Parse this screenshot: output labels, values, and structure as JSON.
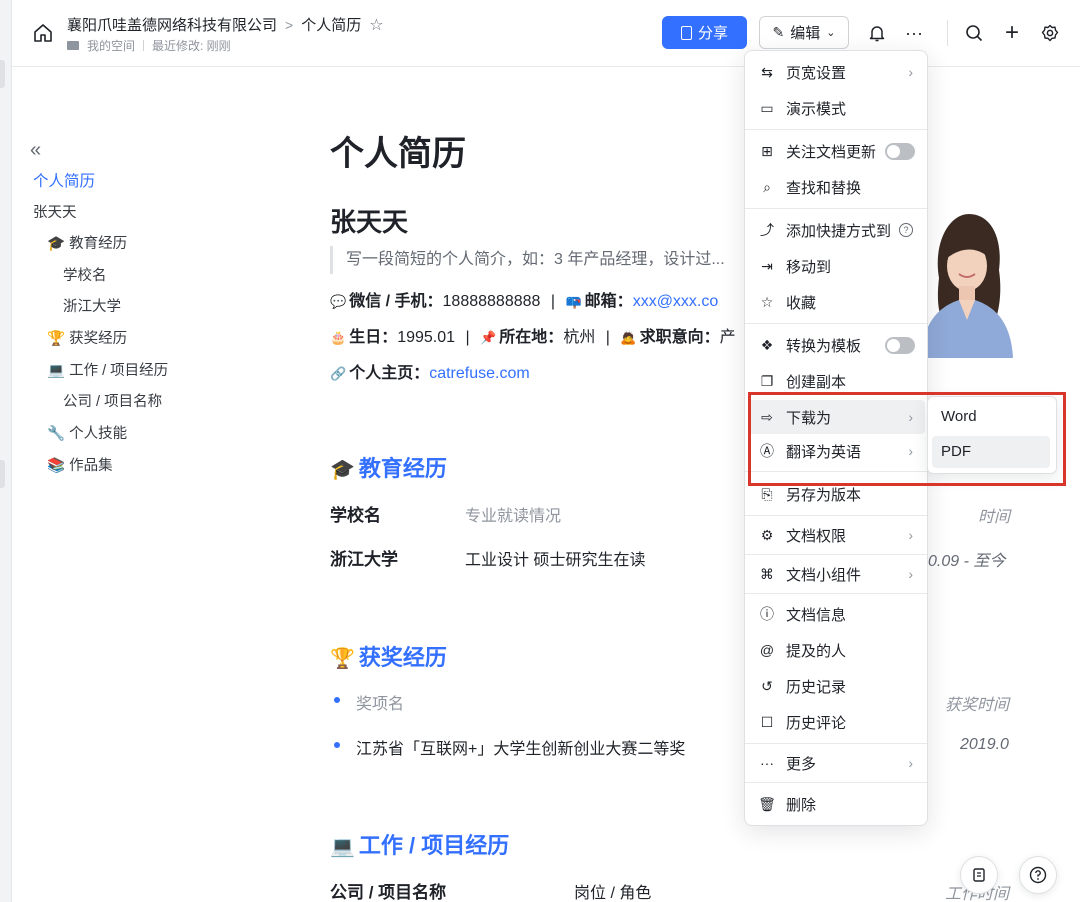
{
  "header": {
    "org_name": "襄阳爪哇盖德网络科技有限公司",
    "crumb_sep": ">",
    "doc_title": "个人简历",
    "space": "我的空间",
    "last_modified": "最近修改: 刚刚",
    "share_label": "分享",
    "edit_label": "编辑"
  },
  "outline": {
    "items": [
      {
        "label": "个人简历"
      },
      {
        "label": "张天天"
      },
      {
        "label": "🎓 教育经历"
      },
      {
        "label": "学校名"
      },
      {
        "label": "浙江大学"
      },
      {
        "label": "🏆 获奖经历"
      },
      {
        "label": "💻 工作 / 项目经历"
      },
      {
        "label": "公司 / 项目名称"
      },
      {
        "label": "🔧 个人技能"
      },
      {
        "label": "📚 作品集"
      }
    ]
  },
  "doc": {
    "title": "个人简历",
    "name": "张天天",
    "intro_placeholder": "写一段简短的个人简介，如：3 年产品经理，设计过...",
    "contact": {
      "wechat_label": "微信 / 手机：",
      "wechat_value": "18888888888",
      "email_label": "邮箱：",
      "email_value": "xxx@xxx.co",
      "birthday_label": "生日：",
      "birthday_value": "1995.01",
      "location_label": "所在地：",
      "location_value": "杭州",
      "job_label": "求职意向：",
      "job_value": "产",
      "homepage_label": "个人主页：",
      "homepage_value": "catrefuse.com",
      "sep": "|"
    },
    "education": {
      "heading": "教育经历",
      "header_row": {
        "school": "学校名",
        "major": "专业就读情况",
        "time": "时间"
      },
      "rows": [
        {
          "school": "浙江大学",
          "major": "工业设计 硕士研究生在读",
          "time": "0.09 - 至今"
        }
      ]
    },
    "awards": {
      "heading": "获奖经历",
      "items": [
        {
          "name": "奖项名",
          "time": "获奖时间"
        },
        {
          "name": "江苏省「互联网+」大学生创新创业大赛二等奖",
          "time": "2019.0"
        }
      ]
    },
    "work": {
      "heading": "工作 / 项目经历",
      "header_row": {
        "company": "公司 / 项目名称",
        "role": "岗位 / 角色",
        "time": "工作时间"
      }
    }
  },
  "menu": {
    "items": [
      {
        "label": "页宽设置"
      },
      {
        "label": "演示模式"
      },
      {
        "label": "关注文档更新"
      },
      {
        "label": "查找和替换"
      },
      {
        "label": "添加快捷方式到"
      },
      {
        "label": "移动到"
      },
      {
        "label": "收藏"
      },
      {
        "label": "转换为模板"
      },
      {
        "label": "创建副本"
      },
      {
        "label": "下载为"
      },
      {
        "label": "翻译为英语"
      },
      {
        "label": "另存为版本"
      },
      {
        "label": "文档权限"
      },
      {
        "label": "文档小组件"
      },
      {
        "label": "文档信息"
      },
      {
        "label": "提及的人"
      },
      {
        "label": "历史记录"
      },
      {
        "label": "历史评论"
      },
      {
        "label": "更多"
      },
      {
        "label": "删除"
      }
    ]
  },
  "submenu": {
    "items": [
      {
        "label": "Word"
      },
      {
        "label": "PDF"
      }
    ]
  },
  "colors": {
    "accent": "#3370ff",
    "highlight_box": "#d9362b"
  }
}
